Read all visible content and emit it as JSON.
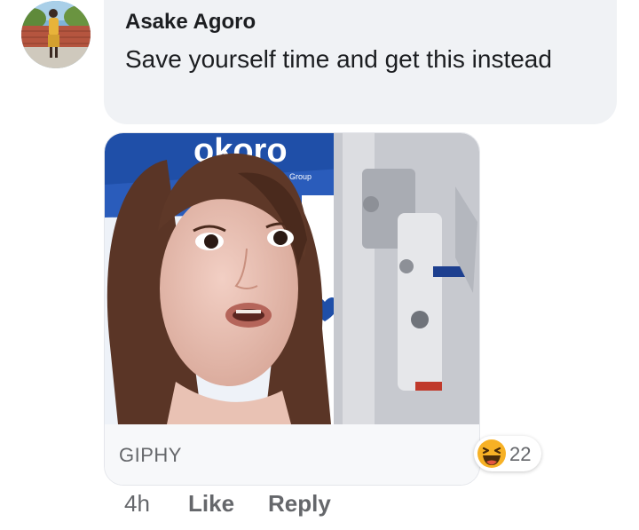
{
  "comment": {
    "author": "Asake Agoro",
    "text": "Save yourself time and get this instead",
    "avatar_icon": "user-avatar-photo"
  },
  "gif": {
    "provider_label": "GIPHY",
    "image_icon": "android-robot-gif"
  },
  "reactions": {
    "icon": "haha-reaction-icon",
    "count": "22"
  },
  "actions": {
    "timestamp": "4h",
    "like_label": "Like",
    "reply_label": "Reply"
  },
  "colors": {
    "bubble_background": "#f0f2f5",
    "secondary_text": "#65676b",
    "primary_text": "#1c1e21",
    "reaction_yellow": "#f7b125"
  }
}
